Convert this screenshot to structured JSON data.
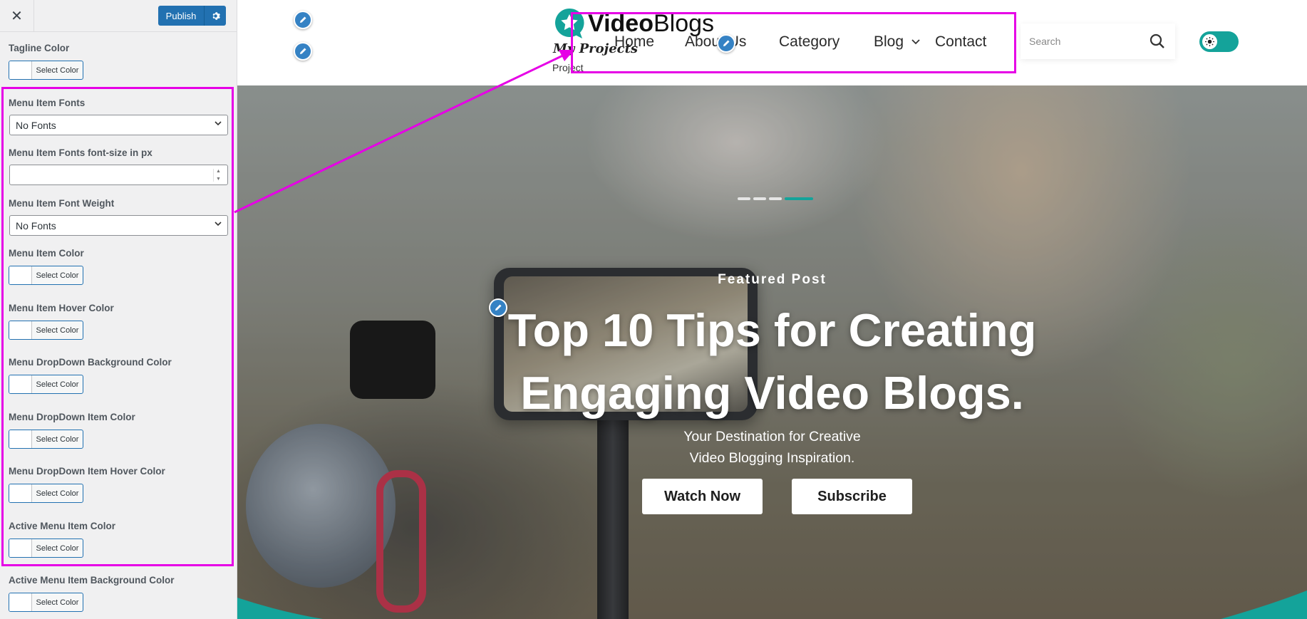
{
  "sidebar": {
    "close_icon": "close-icon",
    "publish_label": "Publish",
    "settings_icon": "gear-icon",
    "controls": {
      "tagline_color": {
        "label": "Tagline Color",
        "button": "Select Color"
      },
      "menu_item_fonts": {
        "label": "Menu Item Fonts",
        "value": "No Fonts"
      },
      "menu_item_font_size": {
        "label": "Menu Item Fonts font-size in px",
        "value": ""
      },
      "menu_item_font_weight": {
        "label": "Menu Item Font Weight",
        "value": "No Fonts"
      },
      "menu_item_color": {
        "label": "Menu Item Color",
        "button": "Select Color"
      },
      "menu_item_hover_color": {
        "label": "Menu Item Hover Color",
        "button": "Select Color"
      },
      "menu_dropdown_bg_color": {
        "label": "Menu DropDown Background Color",
        "button": "Select Color"
      },
      "menu_dropdown_item_color": {
        "label": "Menu DropDown Item Color",
        "button": "Select Color"
      },
      "menu_dropdown_item_hover_color": {
        "label": "Menu DropDown Item Hover Color",
        "button": "Select Color"
      },
      "active_menu_item_color": {
        "label": "Active Menu Item Color",
        "button": "Select Color"
      },
      "active_menu_item_bg_color": {
        "label": "Active Menu Item Background Color",
        "button": "Select Color"
      }
    }
  },
  "site": {
    "logo_bold": "Video",
    "logo_regular": "Blogs",
    "tagline": "My Projects",
    "tagline_sub": "Project",
    "nav": [
      "Home",
      "About Us",
      "Category",
      "Blog",
      "Contact"
    ],
    "search_placeholder": "Search",
    "search_icon": "search-icon",
    "toggle_icon": "sun-icon"
  },
  "hero": {
    "eyebrow": "Featured Post",
    "title_line1": "Top 10 Tips for Creating",
    "title_line2": "Engaging Video Blogs.",
    "subtitle_line1": "Your Destination for Creative",
    "subtitle_line2": "Video Blogging Inspiration.",
    "primary_button": "Watch Now",
    "secondary_button": "Subscribe",
    "slides_total": 4,
    "active_slide": 4
  },
  "colors": {
    "accent": "#14a39a",
    "publish": "#2271b1",
    "highlight": "#e600e6",
    "edit_shortcut": "#3582c4"
  }
}
